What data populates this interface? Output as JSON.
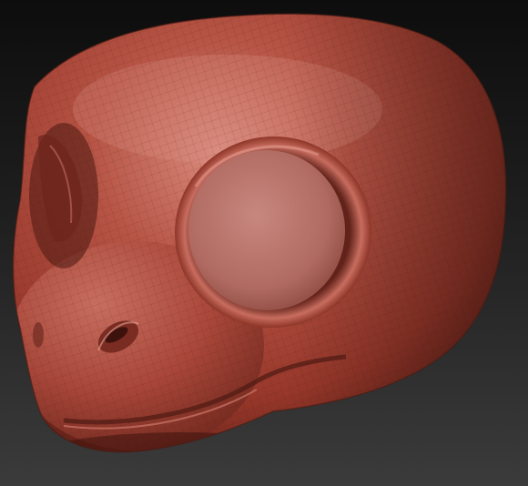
{
  "scene": {
    "subject": "sculpted-head-model",
    "colors": {
      "background_top": "#0d0d0d",
      "background_bottom": "#3b3b3b",
      "clay_base": "#a84536",
      "clay_light": "#d2776a",
      "clay_dark": "#5f2017",
      "eye_socket": "#b9736a",
      "wireframe": "#3a1510"
    }
  }
}
